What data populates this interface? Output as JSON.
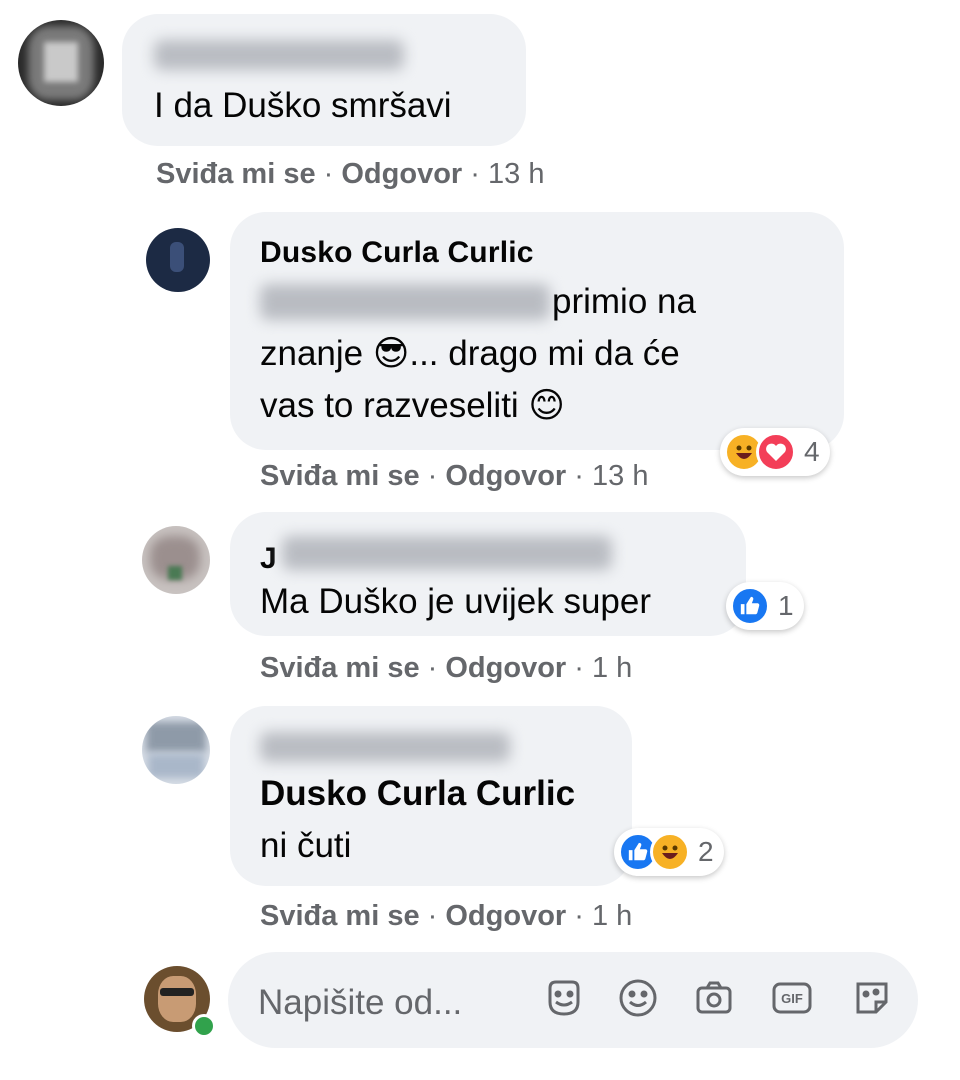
{
  "comment": {
    "text": "I da Duško smršavi",
    "like_label": "Sviđa mi se",
    "reply_label": "Odgovor",
    "time": "13 h"
  },
  "replies": [
    {
      "author": "Dusko Curla Curlic",
      "text_line1": "primio na",
      "text_line2": "znanje 😎... drago mi da će",
      "text_line3": "vas to razveseliti 😊",
      "reactions": [
        "haha",
        "love"
      ],
      "reaction_count": "4",
      "like_label": "Sviđa mi se",
      "reply_label": "Odgovor",
      "time": "13 h"
    },
    {
      "author_initial": "J",
      "text": "Ma Duško je uvijek super",
      "reactions": [
        "like"
      ],
      "reaction_count": "1",
      "like_label": "Sviđa mi se",
      "reply_label": "Odgovor",
      "time": "1 h"
    },
    {
      "mention": "Dusko Curla Curlic",
      "text": "ni čuti",
      "reactions": [
        "like",
        "haha"
      ],
      "reaction_count": "2",
      "like_label": "Sviđa mi se",
      "reply_label": "Odgovor",
      "time": "1 h"
    }
  ],
  "composer": {
    "placeholder": "Napišite od...",
    "icons": [
      "avatar-sticker-icon",
      "emoji-icon",
      "camera-icon",
      "gif-icon",
      "sticker-icon"
    ]
  },
  "colors": {
    "bubble": "#f0f2f5",
    "meta_text": "#65676b",
    "like_blue": "#1877f2",
    "love_red": "#f33e58",
    "haha_yellow": "#f7b125",
    "online_green": "#31a24c"
  }
}
